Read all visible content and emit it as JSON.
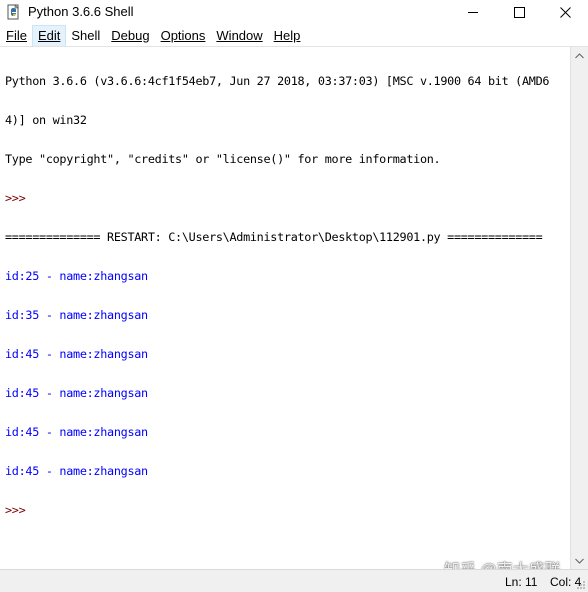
{
  "window": {
    "title": "Python 3.6.6 Shell"
  },
  "menu": {
    "items": [
      {
        "label": "File",
        "name": "menu-file"
      },
      {
        "label": "Edit",
        "name": "menu-edit"
      },
      {
        "label": "Shell",
        "name": "menu-shell"
      },
      {
        "label": "Debug",
        "name": "menu-debug"
      },
      {
        "label": "Options",
        "name": "menu-options"
      },
      {
        "label": "Window",
        "name": "menu-window"
      },
      {
        "label": "Help",
        "name": "menu-help"
      }
    ]
  },
  "shell": {
    "lines": [
      {
        "text": "Python 3.6.6 (v3.6.6:4cf1f54eb7, Jun 27 2018, 03:37:03) [MSC v.1900 64 bit (AMD6",
        "kind": "black"
      },
      {
        "text": "4)] on win32",
        "kind": "black"
      },
      {
        "text": "Type \"copyright\", \"credits\" or \"license()\" for more information.",
        "kind": "black"
      },
      {
        "text": ">>> ",
        "kind": "prompt"
      },
      {
        "text": "============== RESTART: C:\\Users\\Administrator\\Desktop\\112901.py ==============",
        "kind": "restart"
      },
      {
        "text": "id:25 - name:zhangsan",
        "kind": "blue"
      },
      {
        "text": "id:35 - name:zhangsan",
        "kind": "blue"
      },
      {
        "text": "id:45 - name:zhangsan",
        "kind": "blue"
      },
      {
        "text": "id:45 - name:zhangsan",
        "kind": "blue"
      },
      {
        "text": "id:45 - name:zhangsan",
        "kind": "blue"
      },
      {
        "text": "id:45 - name:zhangsan",
        "kind": "blue"
      },
      {
        "text": ">>> ",
        "kind": "prompt"
      }
    ]
  },
  "status": {
    "ln": "Ln: 11",
    "col": "Col: 4"
  },
  "watermark": "知乎 @南大盛联",
  "colors": {
    "output_blue": "#0000ff",
    "prompt": "#7f0000",
    "menu_highlight": "#e5f1fb"
  }
}
